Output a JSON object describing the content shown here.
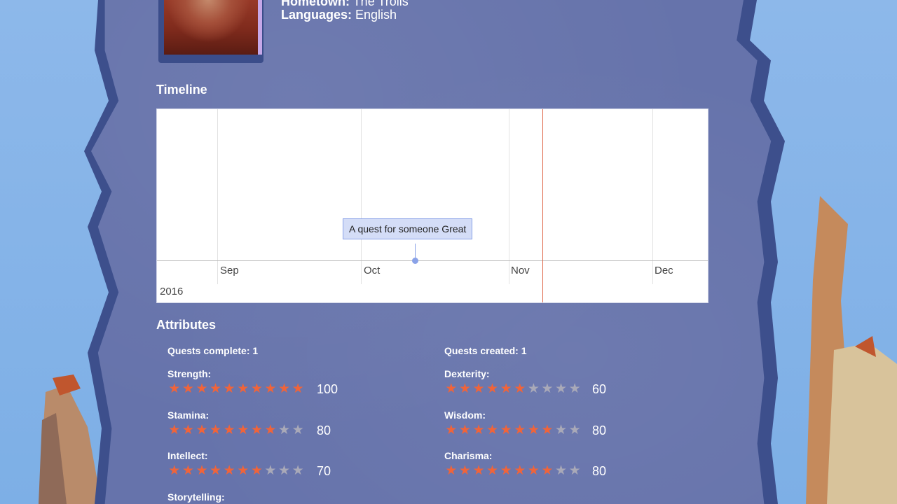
{
  "profile": {
    "hometown_label": "Hometown:",
    "hometown_value": "The Trolls",
    "languages_label": "Languages:",
    "languages_value": "English"
  },
  "timeline": {
    "title": "Timeline",
    "months": [
      "Sep",
      "Oct",
      "Nov",
      "Dec"
    ],
    "year": "2016",
    "event_label": "A quest for someone Great"
  },
  "attributes": {
    "title": "Attributes",
    "quests_complete_label": "Quests complete: 1",
    "quests_created_label": "Quests created: 1",
    "items": [
      {
        "name": "Strength:",
        "value": "100",
        "stars": 10
      },
      {
        "name": "Dexterity:",
        "value": "60",
        "stars": 6
      },
      {
        "name": "Stamina:",
        "value": "80",
        "stars": 8
      },
      {
        "name": "Wisdom:",
        "value": "80",
        "stars": 8
      },
      {
        "name": "Intellect:",
        "value": "70",
        "stars": 7
      },
      {
        "name": "Charisma:",
        "value": "80",
        "stars": 8
      },
      {
        "name": "Storytelling:"
      }
    ],
    "max_stars": 10
  },
  "colors": {
    "star_on": "#f0643a",
    "star_off": "#a9a9b8",
    "panel": "#6673ab",
    "now_line": "#e06a4b"
  }
}
